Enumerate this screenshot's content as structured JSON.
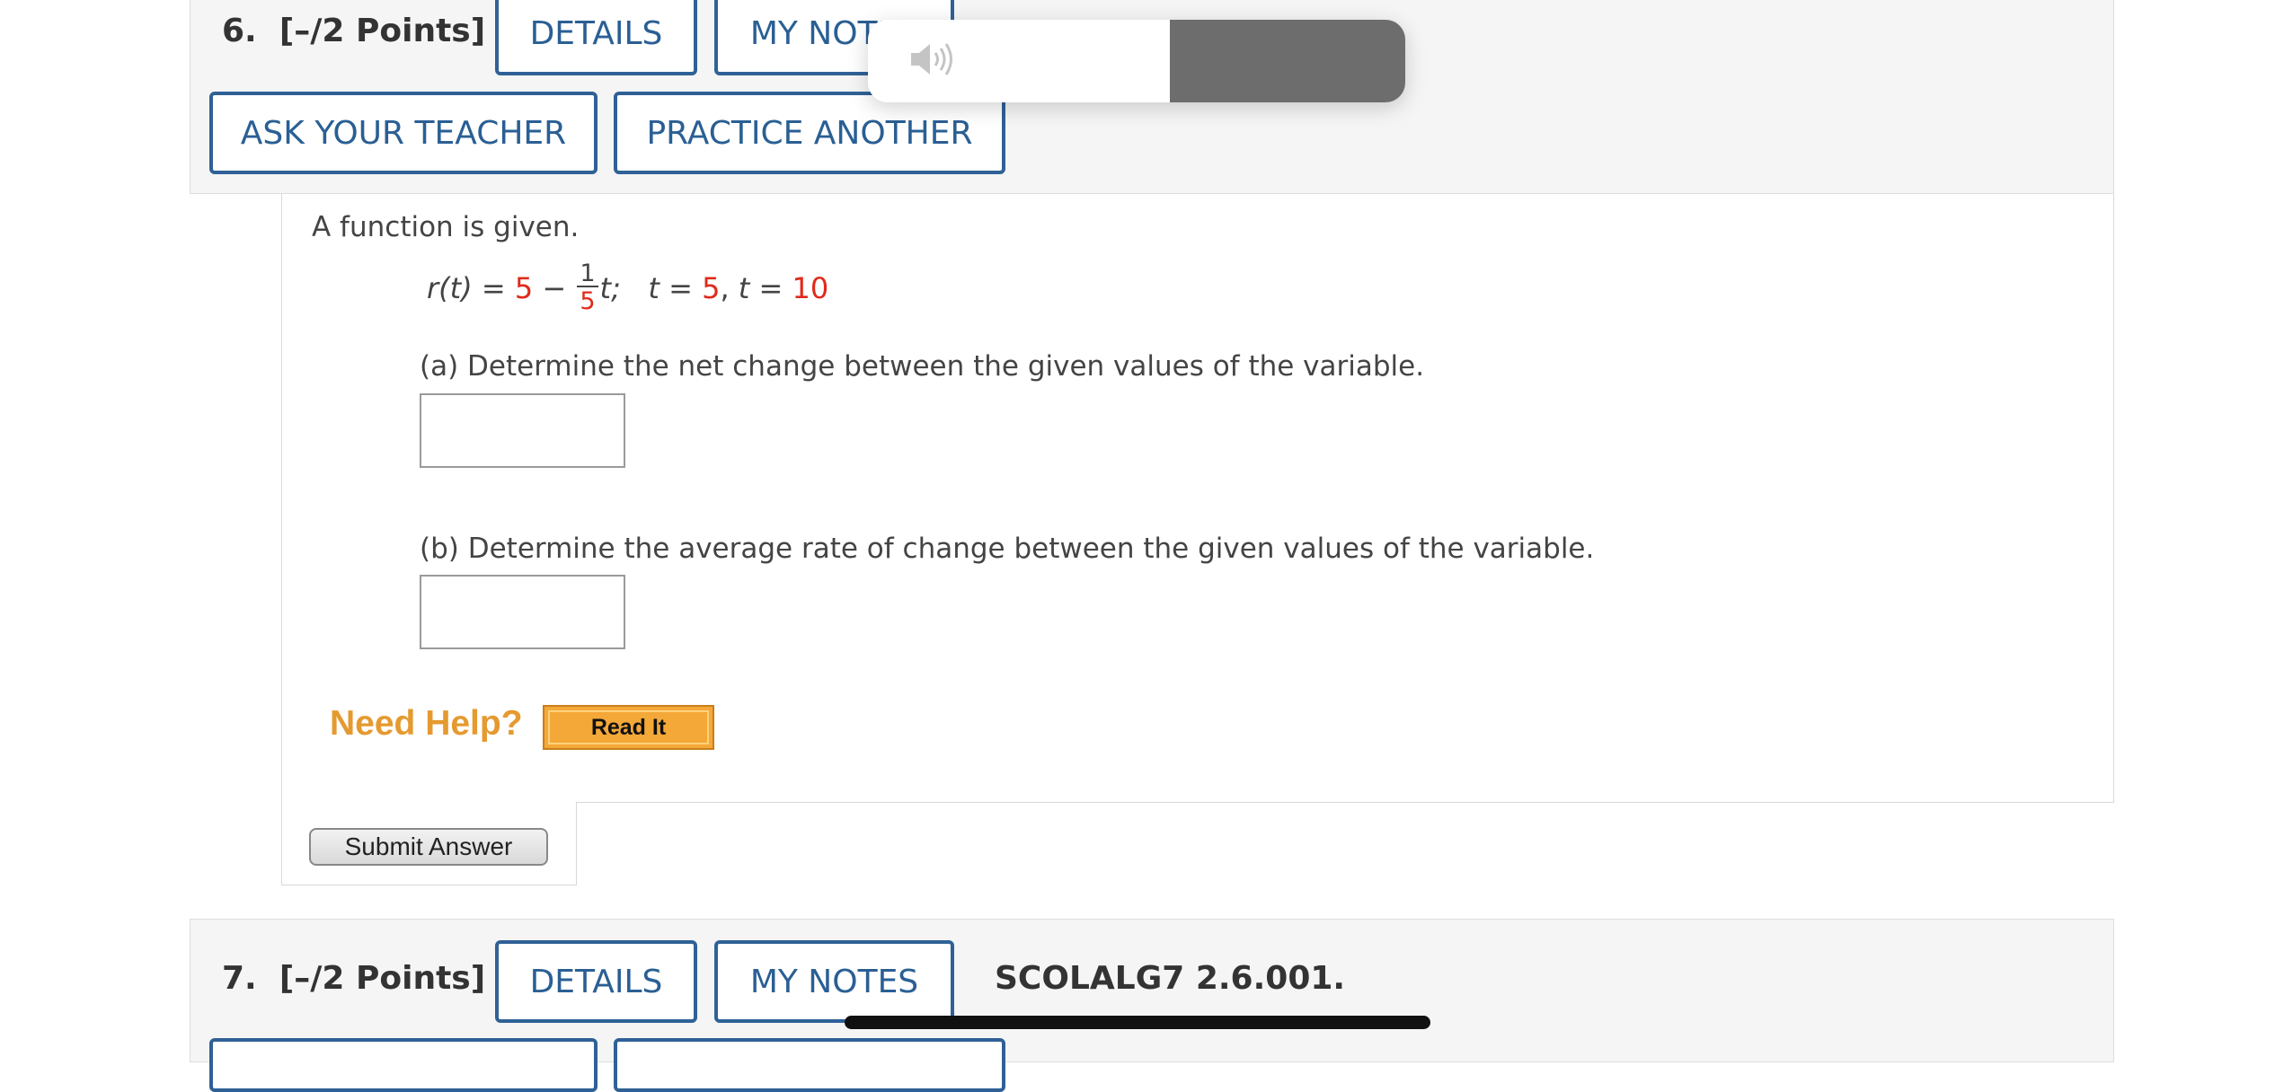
{
  "question6": {
    "number": "6.",
    "points": "[–/2 Points]",
    "details_label": "DETAILS",
    "my_notes_label": "MY NOTES",
    "ask_teacher_label": "ASK YOUR TEACHER",
    "practice_another_label": "PRACTICE ANOTHER",
    "intro": "A function is given.",
    "equation": {
      "lhs": "r(t) = ",
      "const": "5",
      "minus": " − ",
      "frac_num": "1",
      "frac_den": "5",
      "var_semicolon": "t;",
      "t1_label": "t = ",
      "t1_value": "5",
      "comma": ", ",
      "t2_label": "t = ",
      "t2_value": "10"
    },
    "part_a": "(a) Determine the net change between the given values of the variable.",
    "part_a_value": "",
    "part_b": "(b) Determine the average rate of change between the given values of the variable.",
    "part_b_value": "",
    "need_help": "Need Help?",
    "read_it": "Read It",
    "submit": "Submit Answer"
  },
  "question7": {
    "number": "7.",
    "points": "[–/2 Points]",
    "details_label": "DETAILS",
    "my_notes_label": "MY NOTES",
    "code": "SCOLALG7 2.6.001."
  },
  "audio_overlay": {
    "icon": "speaker-icon"
  },
  "colors": {
    "accent_blue": "#2f6196",
    "highlight_red": "#e02a1a",
    "help_orange": "#e59a30",
    "panel_gray": "#f5f5f5"
  }
}
